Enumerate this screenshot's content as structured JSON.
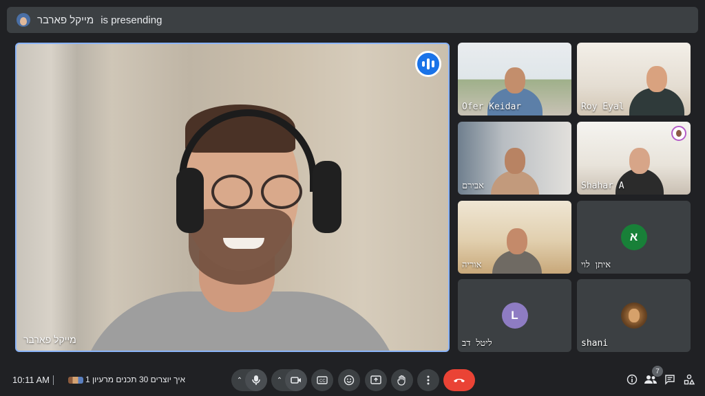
{
  "banner": {
    "presenter_name": "מייקל פארבר",
    "presenting_text": "is presending"
  },
  "main_speaker": {
    "name": "מייקל פארבר"
  },
  "participants": [
    {
      "name": "Ofer Keidar",
      "type": "video"
    },
    {
      "name": "Roy Eyal",
      "type": "video"
    },
    {
      "name": "אבירם",
      "type": "video"
    },
    {
      "name": "Shahar A",
      "type": "video"
    },
    {
      "name": "אוריה",
      "type": "video"
    },
    {
      "name": "איתן לוי",
      "type": "avatar",
      "initial": "א",
      "color": "#188038"
    },
    {
      "name": "ליטל דב",
      "type": "avatar",
      "initial": "L",
      "color": "#8e7cc3"
    },
    {
      "name": "shani",
      "type": "avatar-image",
      "icon": "lion-avatar"
    }
  ],
  "bottom_bar": {
    "time": "10:11 AM",
    "meeting_title": "איך יוצרים 30 תכנים מרעיון 1",
    "people_count": "7"
  },
  "colors": {
    "background": "#202124",
    "tile": "#3c4043",
    "active_border": "#8ab4f8",
    "end_call": "#ea4335",
    "speaking": "#1a73e8"
  },
  "icons": {
    "mic": "mic-icon",
    "camera": "camera-icon",
    "captions": "captions-icon",
    "emoji": "emoji-icon",
    "present": "present-icon",
    "hand": "raise-hand-icon",
    "more": "more-options-icon",
    "end": "end-call-icon",
    "info": "info-icon",
    "people": "people-icon",
    "chat": "chat-icon",
    "activities": "activities-icon"
  }
}
